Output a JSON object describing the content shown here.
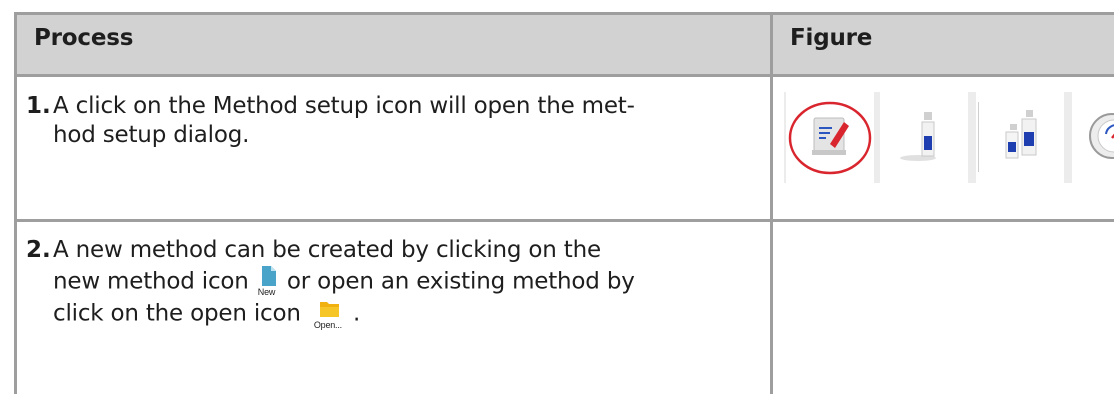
{
  "header": {
    "process": "Process",
    "figure": "Figure"
  },
  "rows": [
    {
      "number": "1.",
      "lines": [
        "A click on the Method setup icon will open the met-",
        "hod setup dialog."
      ]
    },
    {
      "number": "2.",
      "line1": "A new method can be created by clicking on the",
      "line2_a": "new method icon",
      "line2_b": "or open an existing method by",
      "line3_a": "click on the open icon",
      "line3_b": ".",
      "new_icon_label": "New",
      "open_icon_label": "Open..."
    }
  ],
  "colors": {
    "header_bg": "#d2d2d2",
    "rule": "#9e9e9e",
    "highlight_circle": "#d9262e"
  },
  "figure_icons": [
    "method-setup-icon",
    "bottle-icon",
    "two-bottles-icon",
    "gauge-icon"
  ]
}
